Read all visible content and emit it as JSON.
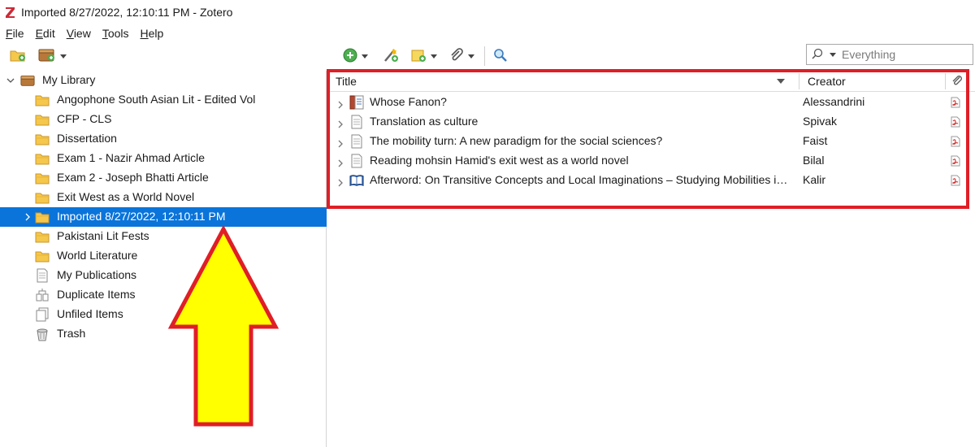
{
  "window": {
    "title": "Imported 8/27/2022, 12:10:11 PM - Zotero",
    "app_logo_letter": "Z",
    "accent_color": "#0a74da",
    "highlight_color": "#e01e26",
    "arrow_fill": "#ffff00"
  },
  "menu": [
    {
      "accel": "F",
      "rest": "ile"
    },
    {
      "accel": "E",
      "rest": "dit"
    },
    {
      "accel": "V",
      "rest": "iew"
    },
    {
      "accel": "T",
      "rest": "ools"
    },
    {
      "accel": "H",
      "rest": "elp"
    }
  ],
  "toolbar": {
    "icons": [
      "new-collection-icon",
      "new-library-icon",
      "new-item-icon",
      "add-by-identifier-icon",
      "new-note-icon",
      "add-attachment-icon",
      "advanced-search-icon"
    ]
  },
  "search": {
    "mode_placeholder": "Everything",
    "value": ""
  },
  "library_tree": {
    "root_label": "My Library",
    "items": [
      {
        "label": "Angophone South Asian Lit - Edited Vol",
        "icon": "folder-icon"
      },
      {
        "label": "CFP - CLS",
        "icon": "folder-icon"
      },
      {
        "label": "Dissertation",
        "icon": "folder-icon"
      },
      {
        "label": "Exam 1 - Nazir Ahmad Article",
        "icon": "folder-icon"
      },
      {
        "label": "Exam 2 - Joseph Bhatti Article",
        "icon": "folder-icon"
      },
      {
        "label": "Exit West as a World Novel",
        "icon": "folder-icon"
      },
      {
        "label": "Imported 8/27/2022, 12:10:11 PM",
        "icon": "folder-icon",
        "selected": true
      },
      {
        "label": "Pakistani Lit Fests",
        "icon": "folder-icon"
      },
      {
        "label": "World Literature",
        "icon": "folder-icon"
      },
      {
        "label": "My Publications",
        "icon": "publications-icon"
      },
      {
        "label": "Duplicate Items",
        "icon": "duplicate-items-icon"
      },
      {
        "label": "Unfiled Items",
        "icon": "unfiled-items-icon"
      },
      {
        "label": "Trash",
        "icon": "trash-icon"
      }
    ]
  },
  "items_table": {
    "columns": {
      "title": "Title",
      "creator": "Creator"
    },
    "rows": [
      {
        "title": "Whose Fanon?",
        "creator": "Alessandrini",
        "type_icon": "book-section-icon"
      },
      {
        "title": "Translation as culture",
        "creator": "Spivak",
        "type_icon": "document-icon"
      },
      {
        "title": "The mobility turn: A new paradigm for the social sciences?",
        "creator": "Faist",
        "type_icon": "document-icon"
      },
      {
        "title": "Reading mohsin Hamid's exit west as a world novel",
        "creator": "Bilal",
        "type_icon": "document-icon"
      },
      {
        "title": "Afterword: On Transitive Concepts and Local Imaginations – Studying Mobilities in the Global South",
        "creator": "Kalir",
        "type_icon": "book-icon"
      }
    ]
  }
}
